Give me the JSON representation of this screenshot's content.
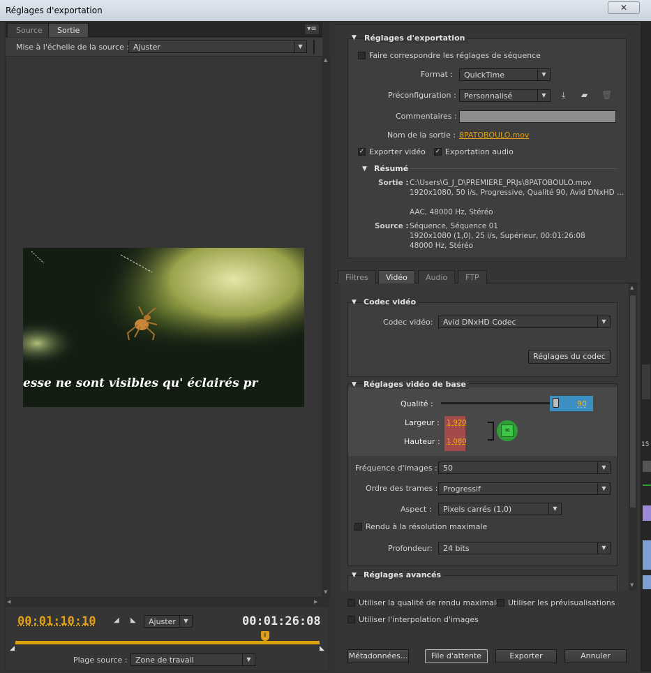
{
  "window": {
    "title": "Réglages d'exportation",
    "close": "✕"
  },
  "left": {
    "tabs": [
      "Source",
      "Sortie"
    ],
    "scale_label": "Mise à l'échelle de la source :",
    "scale_value": "Ajuster",
    "subtitle": "esse ne sont visibles qu' éclairés pr",
    "timecode_current": "00:01:10:10",
    "fit_value": "Ajuster",
    "timecode_duration": "00:01:26:08",
    "range_label": "Plage source :",
    "range_value": "Zone de travail",
    "playhead_progress": 0.82
  },
  "export": {
    "header": "Réglages d'exportation",
    "match_seq": "Faire correspondre les réglages de séquence",
    "format_label": "Format :",
    "format_value": "QuickTime",
    "preset_label": "Préconfiguration :",
    "preset_value": "Personnalisé",
    "comments_label": "Commentaires :",
    "output_label": "Nom de la sortie :",
    "output_value": "8PATOBOULO.mov",
    "export_video": "Exporter vidéo",
    "export_audio": "Exportation audio",
    "summary_header": "Résumé",
    "sortie_label": "Sortie :",
    "sortie_lines": [
      "C:\\Users\\G_J_D\\PREMIERE_PRJs\\8PATOBOULO.mov",
      "1920x1080, 50 i/s, Progressive, Qualité  90, Avid DNxHD ...",
      "",
      "AAC, 48000 Hz, Stéréo"
    ],
    "source_label": "Source :",
    "source_lines": [
      "Séquence, Séquence 01",
      "1920x1080 (1,0), 25  i/s, Supérieur, 00:01:26:08",
      "48000 Hz, Stéréo"
    ]
  },
  "tabs2": [
    "Filtres",
    "Vidéo",
    "Audio",
    "FTP"
  ],
  "video": {
    "codec_header": "Codec vidéo",
    "codec_label": "Codec vidéo:",
    "codec_value": "Avid DNxHD Codec",
    "codec_settings_btn": "Réglages du codec",
    "basic_header": "Réglages vidéo de base",
    "quality_label": "Qualité :",
    "quality_value": "90",
    "quality_fraction": 0.9,
    "width_label": "Largeur :",
    "width_value": "1 920",
    "height_label": "Hauteur :",
    "height_value": "1 080",
    "fps_label": "Fréquence d'images :",
    "fps_value": "50",
    "field_label": "Ordre des trames :",
    "field_value": "Progressif",
    "aspect_label": "Aspect :",
    "aspect_value": "Pixels carrés (1,0)",
    "max_render": "Rendu à la résolution maximale",
    "depth_label": "Profondeur:",
    "depth_value": "24 bits",
    "advanced_header": "Réglages avancés"
  },
  "bottom": {
    "max_quality": "Utiliser la qualité de rendu maximale",
    "use_previews": "Utiliser les prévisualisations",
    "frame_blend": "Utiliser l'interpolation d'images",
    "metadata_btn": "Métadonnées...",
    "queue_btn": "File d'attente",
    "export_btn": "Exporter",
    "cancel_btn": "Annuler"
  },
  "ext": {
    "number": "15"
  },
  "colors": {
    "accent": "#e0a019",
    "quality_bg": "#3b8fc2",
    "dim_bg": "#a34a4a",
    "link_green": "#2fa037"
  }
}
